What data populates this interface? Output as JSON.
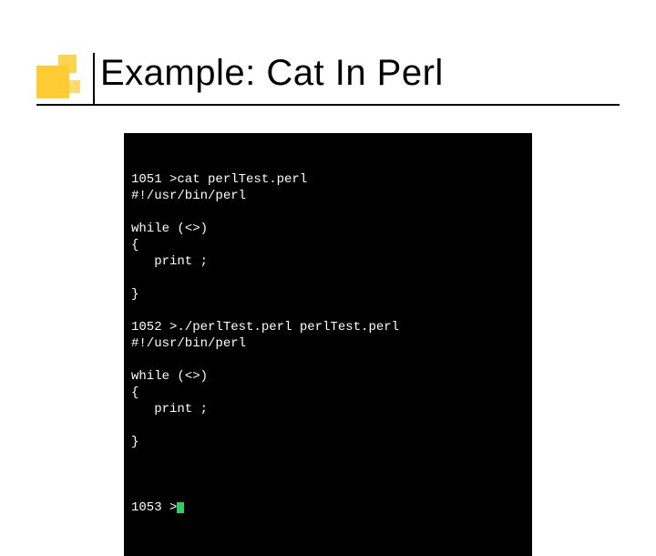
{
  "title": "Example: Cat In Perl",
  "terminal": {
    "lines": [
      "1051 >cat perlTest.perl",
      "#!/usr/bin/perl",
      "",
      "while (<>)",
      "{",
      "   print ;",
      "",
      "}",
      "",
      "1052 >./perlTest.perl perlTest.perl",
      "#!/usr/bin/perl",
      "",
      "while (<>)",
      "{",
      "   print ;",
      "",
      "}",
      ""
    ],
    "final_prompt": "1053 >"
  }
}
